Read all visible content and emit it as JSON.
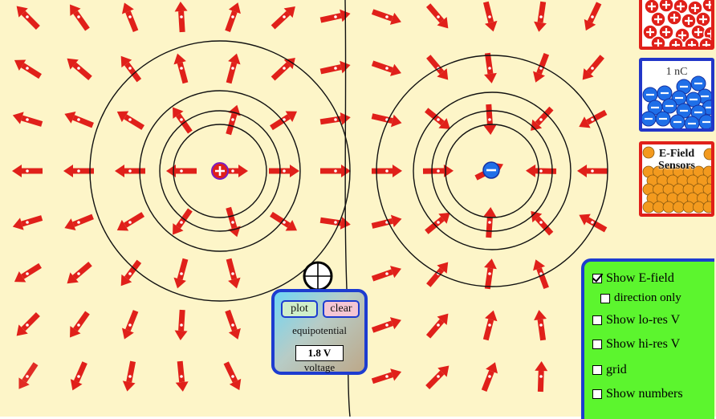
{
  "buckets": {
    "negative_label": "1 nC",
    "sensors_label_line1": "E-Field",
    "sensors_label_line2": "Sensors"
  },
  "charges": [
    {
      "sign": "positive",
      "symbol": "+"
    },
    {
      "sign": "negative",
      "symbol": "−"
    }
  ],
  "voltmeter": {
    "plot_label": "plot",
    "clear_label": "clear",
    "equipotential_label": "equipotential",
    "voltage_value": "1.8 V",
    "voltage_label": "voltage"
  },
  "options": [
    {
      "label": "Show E-field",
      "checked": true
    },
    {
      "label": "direction only",
      "checked": false
    },
    {
      "label": "Show lo-res V",
      "checked": false
    },
    {
      "label": "Show hi-res V",
      "checked": false
    },
    {
      "label": "grid",
      "checked": false
    },
    {
      "label": "Show numbers",
      "checked": false
    }
  ],
  "colors": {
    "background": "#fdf5c8",
    "positive": "#e0201a",
    "negative": "#1f6fe8",
    "panel_green": "#5cf52e",
    "panel_border": "#1d3cd0",
    "sensor_orange": "#f39a1e"
  }
}
